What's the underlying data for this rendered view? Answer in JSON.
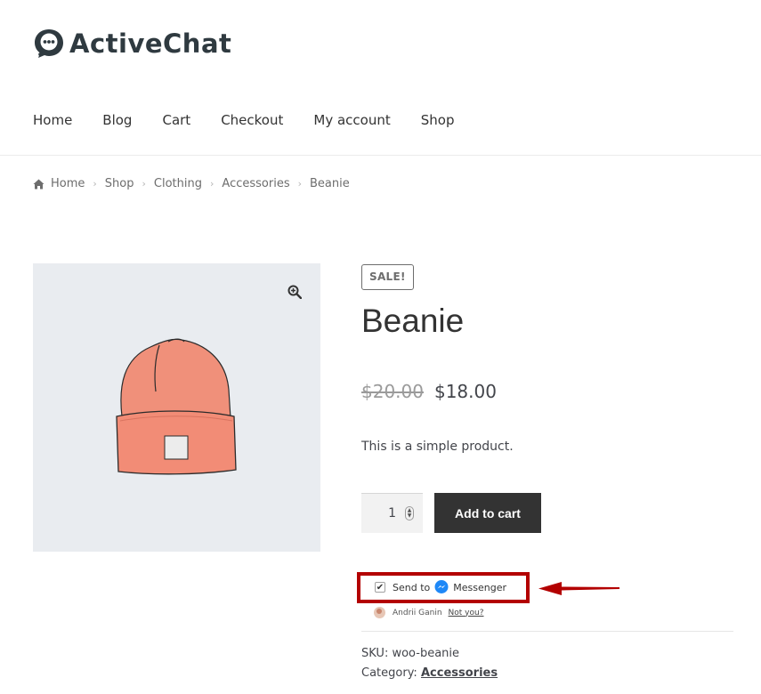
{
  "site": {
    "logo_text": "ActiveChat"
  },
  "nav": {
    "items": [
      "Home",
      "Blog",
      "Cart",
      "Checkout",
      "My account",
      "Shop"
    ]
  },
  "breadcrumb": {
    "items": [
      "Home",
      "Shop",
      "Clothing",
      "Accessories"
    ],
    "current": "Beanie"
  },
  "product": {
    "badge": "SALE!",
    "title": "Beanie",
    "old_price": "$20.00",
    "price": "$18.00",
    "description": "This is a simple product.",
    "quantity": "1",
    "add_to_cart": "Add to cart",
    "sku_label": "SKU:",
    "sku": "woo-beanie",
    "category_label": "Category:",
    "category": "Accessories"
  },
  "messenger": {
    "send_to": "Send to",
    "messenger": "Messenger",
    "checked": true,
    "user_name": "Andrii Ganin",
    "not_you": "Not you?"
  },
  "colors": {
    "highlight": "#b30000",
    "button_bg": "#333333",
    "image_bg": "#e9ecf0",
    "messenger_blue": "#1e88f7"
  }
}
